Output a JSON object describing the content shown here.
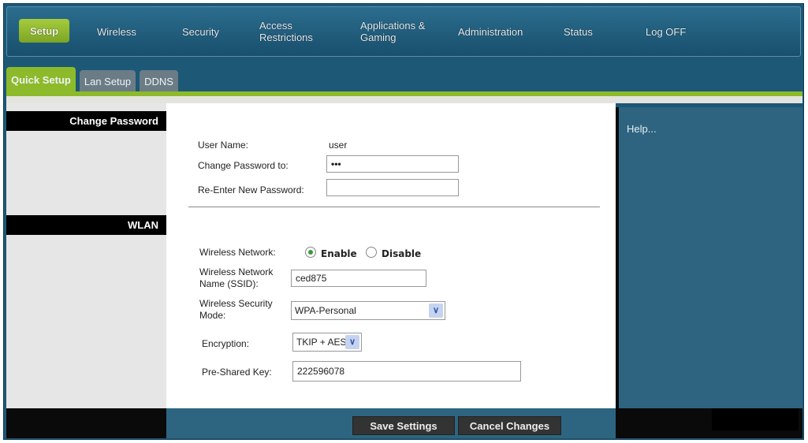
{
  "nav": {
    "items": [
      "Setup",
      "Wireless",
      "Security",
      "Access Restrictions",
      "Applications & Gaming",
      "Administration",
      "Status",
      "Log OFF"
    ],
    "active": "Setup"
  },
  "tabs": [
    "Quick Setup",
    "Lan Setup",
    "DDNS"
  ],
  "sections": {
    "change_password": "Change Password",
    "wlan": "WLAN"
  },
  "help": "Help...",
  "password": {
    "user_name_label": "User Name:",
    "user_name_value": "user",
    "change_label": "Change Password to:",
    "change_value": "•••",
    "reenter_label": "Re-Enter New Password:",
    "reenter_value": ""
  },
  "wlan": {
    "network_label": "Wireless Network:",
    "enable": "Enable",
    "disable": "Disable",
    "selected": "Enable",
    "ssid_label_1": "Wireless Network",
    "ssid_label_2": "Name (SSID):",
    "ssid_value": "ced875",
    "mode_label_1": "Wireless Security",
    "mode_label_2": "Mode:",
    "mode_value": "WPA-Personal",
    "encryption_label": "Encryption:",
    "encryption_value": "TKIP + AES",
    "psk_label": "Pre-Shared Key:",
    "psk_value": "222596078"
  },
  "buttons": {
    "save": "Save Settings",
    "cancel": "Cancel Changes"
  },
  "colors": {
    "accent_green": "#8dba2b",
    "nav_blue": "#1d5876",
    "panel_blue": "#2e6480"
  }
}
